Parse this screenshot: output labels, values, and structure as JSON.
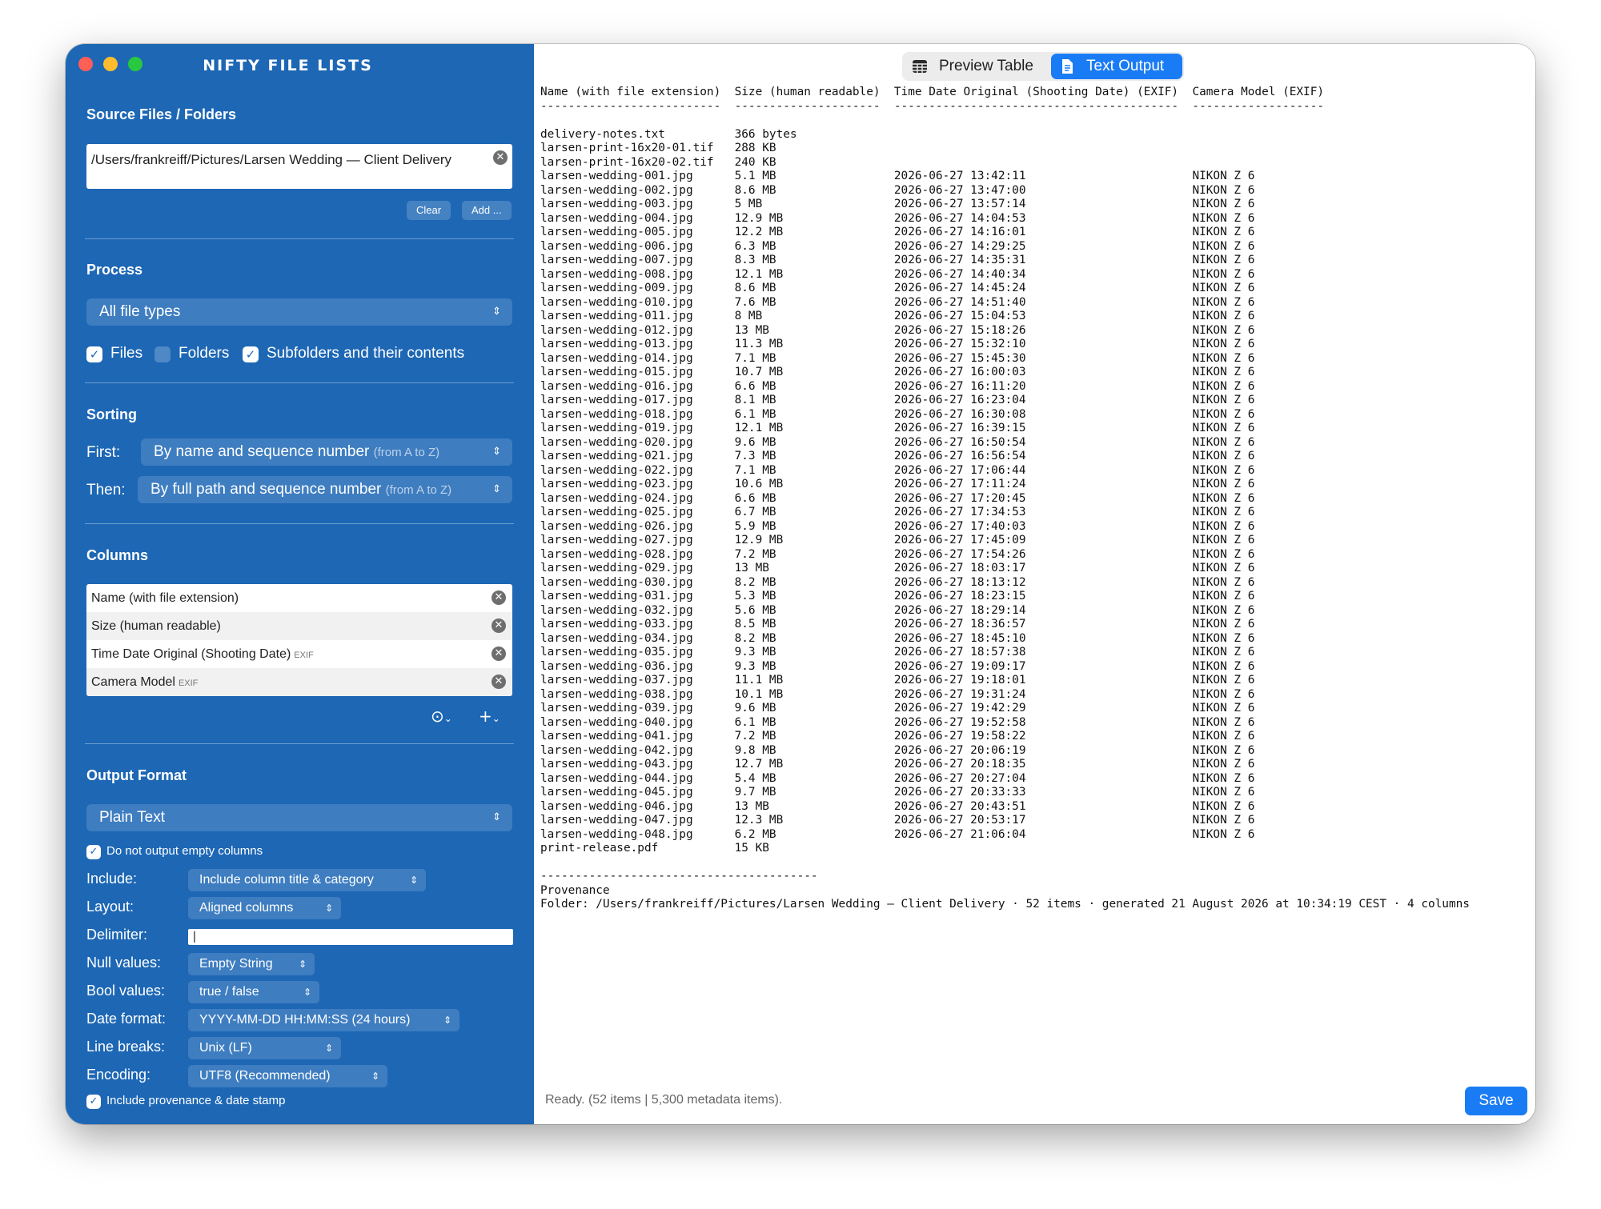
{
  "app": {
    "title": "NIFTY FILE LISTS"
  },
  "source": {
    "heading": "Source Files / Folders",
    "path": "/Users/frankreiff/Pictures/Larsen Wedding — Client Delivery",
    "clear_label": "Clear",
    "add_label": "Add ..."
  },
  "process": {
    "heading": "Process",
    "file_types": "All file types",
    "files_label": "Files",
    "files_checked": true,
    "folders_label": "Folders",
    "folders_checked": false,
    "subfolders_label": "Subfolders and their contents",
    "subfolders_checked": true
  },
  "sorting": {
    "heading": "Sorting",
    "first_label": "First:",
    "first_value": "By name and sequence number",
    "first_hint": "(from A to Z)",
    "then_label": "Then:",
    "then_value": "By full path and sequence number",
    "then_hint": "(from A to Z)"
  },
  "columns": {
    "heading": "Columns",
    "items": [
      {
        "label": "Name (with file extension)",
        "category": ""
      },
      {
        "label": "Size (human readable)",
        "category": ""
      },
      {
        "label": "Time Date Original (Shooting Date)",
        "category": "EXIF"
      },
      {
        "label": "Camera Model",
        "category": "EXIF"
      }
    ]
  },
  "output_format": {
    "heading": "Output Format",
    "format": "Plain Text",
    "no_empty_label": "Do not output empty columns",
    "no_empty_checked": true,
    "include_label": "Include:",
    "include_value": "Include column title & category",
    "layout_label": "Layout:",
    "layout_value": "Aligned columns",
    "delimiter_label": "Delimiter:",
    "delimiter_value": "|",
    "null_label": "Null values:",
    "null_value": "Empty String",
    "bool_label": "Bool values:",
    "bool_value": "true / false",
    "date_label": "Date format:",
    "date_value": "YYYY-MM-DD HH:MM:SS (24 hours)",
    "linebreaks_label": "Line breaks:",
    "linebreaks_value": "Unix (LF)",
    "encoding_label": "Encoding:",
    "encoding_value": "UTF8 (Recommended)",
    "provenance_label": "Include provenance & date stamp",
    "provenance_checked": true
  },
  "toolbar": {
    "preview_table_label": "Preview Table",
    "text_output_label": "Text Output",
    "active_tab": "Text Output"
  },
  "output": {
    "header": [
      "Name (with file extension)",
      "Size (human readable)",
      "Time Date Original (Shooting Date) (EXIF)",
      "Camera Model (EXIF)"
    ],
    "rows": [
      [
        "delivery-notes.txt",
        "366 bytes",
        "",
        ""
      ],
      [
        "larsen-print-16x20-01.tif",
        "288 KB",
        "",
        ""
      ],
      [
        "larsen-print-16x20-02.tif",
        "240 KB",
        "",
        ""
      ],
      [
        "larsen-wedding-001.jpg",
        "5.1 MB",
        "2026-06-27 13:42:11",
        "NIKON Z 6"
      ],
      [
        "larsen-wedding-002.jpg",
        "8.6 MB",
        "2026-06-27 13:47:00",
        "NIKON Z 6"
      ],
      [
        "larsen-wedding-003.jpg",
        "5 MB",
        "2026-06-27 13:57:14",
        "NIKON Z 6"
      ],
      [
        "larsen-wedding-004.jpg",
        "12.9 MB",
        "2026-06-27 14:04:53",
        "NIKON Z 6"
      ],
      [
        "larsen-wedding-005.jpg",
        "12.2 MB",
        "2026-06-27 14:16:01",
        "NIKON Z 6"
      ],
      [
        "larsen-wedding-006.jpg",
        "6.3 MB",
        "2026-06-27 14:29:25",
        "NIKON Z 6"
      ],
      [
        "larsen-wedding-007.jpg",
        "8.3 MB",
        "2026-06-27 14:35:31",
        "NIKON Z 6"
      ],
      [
        "larsen-wedding-008.jpg",
        "12.1 MB",
        "2026-06-27 14:40:34",
        "NIKON Z 6"
      ],
      [
        "larsen-wedding-009.jpg",
        "8.6 MB",
        "2026-06-27 14:45:24",
        "NIKON Z 6"
      ],
      [
        "larsen-wedding-010.jpg",
        "7.6 MB",
        "2026-06-27 14:51:40",
        "NIKON Z 6"
      ],
      [
        "larsen-wedding-011.jpg",
        "8 MB",
        "2026-06-27 15:04:53",
        "NIKON Z 6"
      ],
      [
        "larsen-wedding-012.jpg",
        "13 MB",
        "2026-06-27 15:18:26",
        "NIKON Z 6"
      ],
      [
        "larsen-wedding-013.jpg",
        "11.3 MB",
        "2026-06-27 15:32:10",
        "NIKON Z 6"
      ],
      [
        "larsen-wedding-014.jpg",
        "7.1 MB",
        "2026-06-27 15:45:30",
        "NIKON Z 6"
      ],
      [
        "larsen-wedding-015.jpg",
        "10.7 MB",
        "2026-06-27 16:00:03",
        "NIKON Z 6"
      ],
      [
        "larsen-wedding-016.jpg",
        "6.6 MB",
        "2026-06-27 16:11:20",
        "NIKON Z 6"
      ],
      [
        "larsen-wedding-017.jpg",
        "8.1 MB",
        "2026-06-27 16:23:04",
        "NIKON Z 6"
      ],
      [
        "larsen-wedding-018.jpg",
        "6.1 MB",
        "2026-06-27 16:30:08",
        "NIKON Z 6"
      ],
      [
        "larsen-wedding-019.jpg",
        "12.1 MB",
        "2026-06-27 16:39:15",
        "NIKON Z 6"
      ],
      [
        "larsen-wedding-020.jpg",
        "9.6 MB",
        "2026-06-27 16:50:54",
        "NIKON Z 6"
      ],
      [
        "larsen-wedding-021.jpg",
        "7.3 MB",
        "2026-06-27 16:56:54",
        "NIKON Z 6"
      ],
      [
        "larsen-wedding-022.jpg",
        "7.1 MB",
        "2026-06-27 17:06:44",
        "NIKON Z 6"
      ],
      [
        "larsen-wedding-023.jpg",
        "10.6 MB",
        "2026-06-27 17:11:24",
        "NIKON Z 6"
      ],
      [
        "larsen-wedding-024.jpg",
        "6.6 MB",
        "2026-06-27 17:20:45",
        "NIKON Z 6"
      ],
      [
        "larsen-wedding-025.jpg",
        "6.7 MB",
        "2026-06-27 17:34:53",
        "NIKON Z 6"
      ],
      [
        "larsen-wedding-026.jpg",
        "5.9 MB",
        "2026-06-27 17:40:03",
        "NIKON Z 6"
      ],
      [
        "larsen-wedding-027.jpg",
        "12.9 MB",
        "2026-06-27 17:45:09",
        "NIKON Z 6"
      ],
      [
        "larsen-wedding-028.jpg",
        "7.2 MB",
        "2026-06-27 17:54:26",
        "NIKON Z 6"
      ],
      [
        "larsen-wedding-029.jpg",
        "13 MB",
        "2026-06-27 18:03:17",
        "NIKON Z 6"
      ],
      [
        "larsen-wedding-030.jpg",
        "8.2 MB",
        "2026-06-27 18:13:12",
        "NIKON Z 6"
      ],
      [
        "larsen-wedding-031.jpg",
        "5.3 MB",
        "2026-06-27 18:23:15",
        "NIKON Z 6"
      ],
      [
        "larsen-wedding-032.jpg",
        "5.6 MB",
        "2026-06-27 18:29:14",
        "NIKON Z 6"
      ],
      [
        "larsen-wedding-033.jpg",
        "8.5 MB",
        "2026-06-27 18:36:57",
        "NIKON Z 6"
      ],
      [
        "larsen-wedding-034.jpg",
        "8.2 MB",
        "2026-06-27 18:45:10",
        "NIKON Z 6"
      ],
      [
        "larsen-wedding-035.jpg",
        "9.3 MB",
        "2026-06-27 18:57:38",
        "NIKON Z 6"
      ],
      [
        "larsen-wedding-036.jpg",
        "9.3 MB",
        "2026-06-27 19:09:17",
        "NIKON Z 6"
      ],
      [
        "larsen-wedding-037.jpg",
        "11.1 MB",
        "2026-06-27 19:18:01",
        "NIKON Z 6"
      ],
      [
        "larsen-wedding-038.jpg",
        "10.1 MB",
        "2026-06-27 19:31:24",
        "NIKON Z 6"
      ],
      [
        "larsen-wedding-039.jpg",
        "9.6 MB",
        "2026-06-27 19:42:29",
        "NIKON Z 6"
      ],
      [
        "larsen-wedding-040.jpg",
        "6.1 MB",
        "2026-06-27 19:52:58",
        "NIKON Z 6"
      ],
      [
        "larsen-wedding-041.jpg",
        "7.2 MB",
        "2026-06-27 19:58:22",
        "NIKON Z 6"
      ],
      [
        "larsen-wedding-042.jpg",
        "9.8 MB",
        "2026-06-27 20:06:19",
        "NIKON Z 6"
      ],
      [
        "larsen-wedding-043.jpg",
        "12.7 MB",
        "2026-06-27 20:18:35",
        "NIKON Z 6"
      ],
      [
        "larsen-wedding-044.jpg",
        "5.4 MB",
        "2026-06-27 20:27:04",
        "NIKON Z 6"
      ],
      [
        "larsen-wedding-045.jpg",
        "9.7 MB",
        "2026-06-27 20:33:33",
        "NIKON Z 6"
      ],
      [
        "larsen-wedding-046.jpg",
        "13 MB",
        "2026-06-27 20:43:51",
        "NIKON Z 6"
      ],
      [
        "larsen-wedding-047.jpg",
        "12.3 MB",
        "2026-06-27 20:53:17",
        "NIKON Z 6"
      ],
      [
        "larsen-wedding-048.jpg",
        "6.2 MB",
        "2026-06-27 21:06:04",
        "NIKON Z 6"
      ],
      [
        "print-release.pdf",
        "15 KB",
        "",
        ""
      ]
    ],
    "provenance_heading": "Provenance",
    "provenance_line": "Folder: /Users/frankreiff/Pictures/Larsen Wedding — Client Delivery · 52 items · generated 21 August 2026 at 10:34:19 CEST · 4 columns"
  },
  "status": {
    "text": "Ready. (52 items | 5,300 metadata items)."
  },
  "save_label": "Save",
  "icons": {
    "traffic": [
      "close-window-icon",
      "minimize-window-icon",
      "zoom-window-icon"
    ],
    "table": "table-icon",
    "document": "document-icon",
    "more": "ellipsis-circle-icon",
    "add": "plus-icon"
  },
  "colors": {
    "sidebar": "#1d67b5",
    "accent": "#1a7cf5",
    "close": "#fe5f57",
    "minimize": "#febc2e",
    "zoom": "#28c840"
  }
}
